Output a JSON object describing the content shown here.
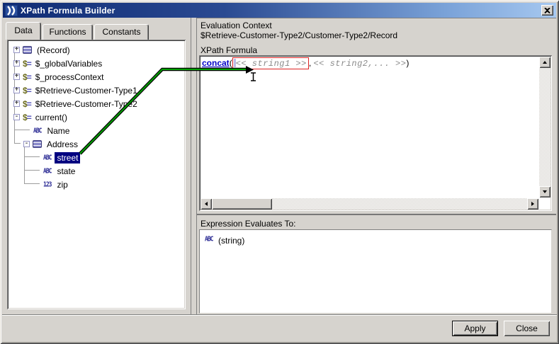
{
  "window": {
    "title": "XPath Formula Builder"
  },
  "tabs": [
    {
      "label": "Data",
      "selected": true
    },
    {
      "label": "Functions",
      "selected": false
    },
    {
      "label": "Constants",
      "selected": false
    }
  ],
  "tree": {
    "items": [
      {
        "label": "(Record)",
        "icon": "element-icon",
        "expand": "+",
        "level": 0,
        "selected": false
      },
      {
        "label": "$_globalVariables",
        "icon": "variable-icon",
        "expand": "+",
        "level": 0,
        "selected": false
      },
      {
        "label": "$_processContext",
        "icon": "variable-icon",
        "expand": "+",
        "level": 0,
        "selected": false
      },
      {
        "label": "$Retrieve-Customer-Type1",
        "icon": "variable-icon",
        "expand": "+",
        "level": 0,
        "selected": false
      },
      {
        "label": "$Retrieve-Customer-Type2",
        "icon": "variable-icon",
        "expand": "+",
        "level": 0,
        "selected": false
      },
      {
        "label": "current()",
        "icon": "variable-icon",
        "expand": "-",
        "level": 0,
        "selected": false
      },
      {
        "label": "Name",
        "icon": "string-icon",
        "expand": "",
        "level": 1,
        "selected": false
      },
      {
        "label": "Address",
        "icon": "element-icon",
        "expand": "-",
        "level": 1,
        "selected": false
      },
      {
        "label": "street",
        "icon": "string-icon",
        "expand": "",
        "level": 2,
        "selected": true
      },
      {
        "label": "state",
        "icon": "string-icon",
        "expand": "",
        "level": 2,
        "selected": false
      },
      {
        "label": "zip",
        "icon": "number-icon",
        "expand": "",
        "level": 2,
        "selected": false
      }
    ]
  },
  "icons": {
    "dollar": "$",
    "equals": "=",
    "string_glyph": "ABC",
    "number_glyph": "123"
  },
  "evaluation_context": {
    "label": "Evaluation Context",
    "value": "$Retrieve-Customer-Type2/Customer-Type2/Record"
  },
  "xpath_formula": {
    "label": "XPath Formula",
    "function_name": "concat",
    "open_paren": "(",
    "arg1_placeholder": "<< string1 >>",
    "separator": ", ",
    "arg2_placeholder": "<< string2,... >>",
    "close_paren": ")"
  },
  "expression_evaluates": {
    "label": "Expression Evaluates To:",
    "type_icon": "string-icon",
    "value": "(string)"
  },
  "buttons": {
    "apply": "Apply",
    "close": "Close"
  },
  "colors": {
    "titlebar_gradient_start": "#0f2b74",
    "titlebar_gradient_end": "#a6c8f0",
    "window_face": "#d6d3ce",
    "tree_selection": "#000080",
    "drag_line_green": "#00a400",
    "drop_target_red": "#dd2222",
    "function_link_blue": "#0000c8",
    "placeholder_gray": "#8a8a8a",
    "icon_navy": "#2b2b94"
  }
}
